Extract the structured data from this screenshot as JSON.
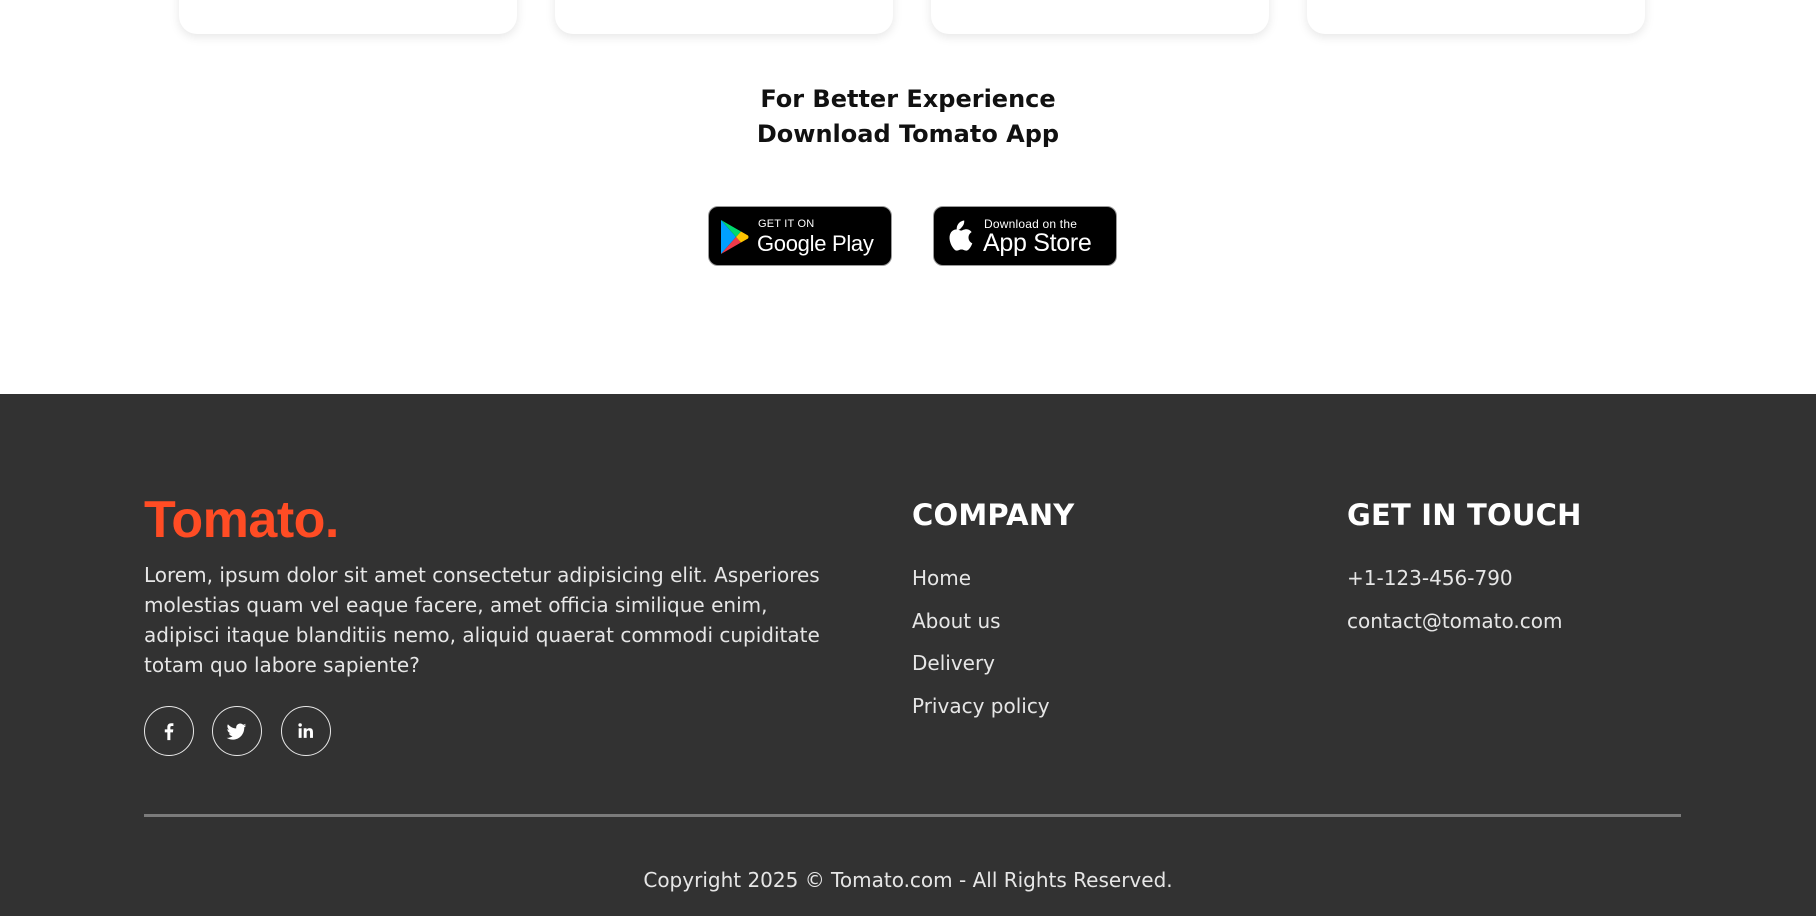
{
  "app_section": {
    "title": "For Better Experience Download Tomato App",
    "google_play": {
      "small": "GET IT ON",
      "big": "Google Play"
    },
    "app_store": {
      "small": "Download on the",
      "big": "App Store"
    }
  },
  "footer": {
    "brand": "Tomato.",
    "about": "Lorem, ipsum dolor sit amet consectetur adipisicing elit. Asperiores molestias quam vel eaque facere, amet officia similique enim, adipisci itaque blanditiis nemo, aliquid quaerat commodi cupiditate totam quo labore sapiente?",
    "socials": [
      "facebook-icon",
      "twitter-icon",
      "linkedin-icon"
    ],
    "company": {
      "title": "COMPANY",
      "links": [
        "Home",
        "About us",
        "Delivery",
        "Privacy policy"
      ]
    },
    "contact": {
      "title": "GET IN TOUCH",
      "items": [
        "+1-123-456-790",
        "contact@tomato.com"
      ]
    },
    "copyright": "Copyright 2025 © Tomato.com - All Rights Reserved."
  },
  "colors": {
    "brand": "#ff4c24",
    "footer_bg": "#323232",
    "store_btn_bg": "#000000"
  }
}
